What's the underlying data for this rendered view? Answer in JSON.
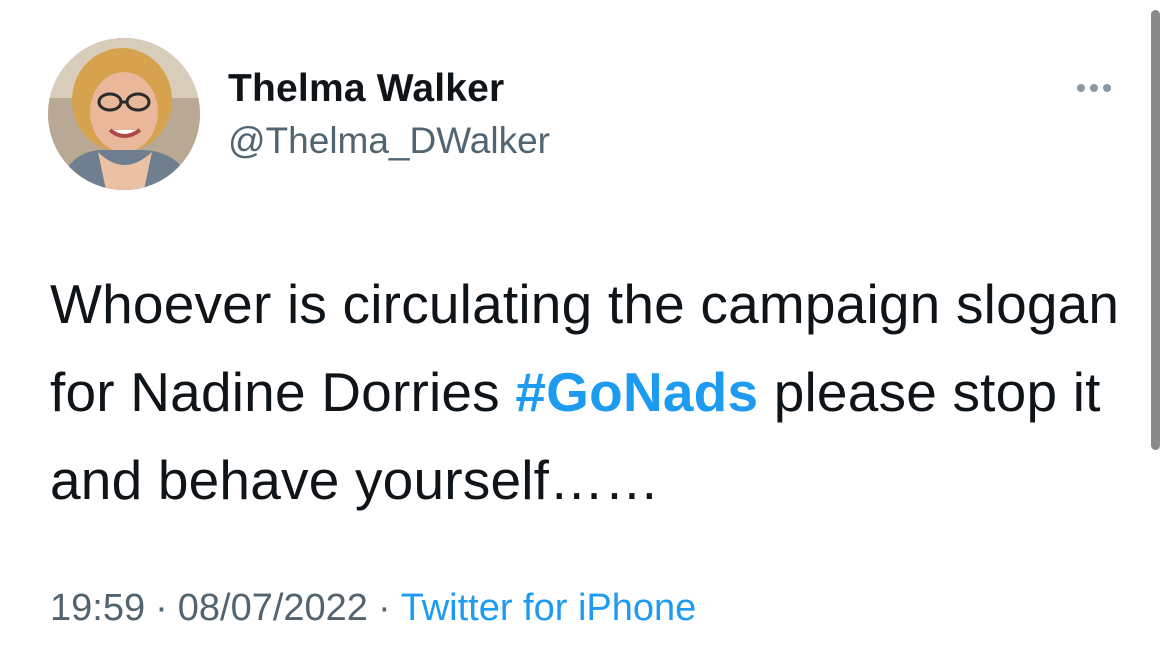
{
  "author": {
    "display_name": "Thelma Walker",
    "handle": "@Thelma_DWalker",
    "avatar_icon": "profile-photo"
  },
  "tweet": {
    "text_before": "Whoever is circulating the campaign slogan for Nadine Dorries ",
    "hashtag": "#GoNads",
    "text_after": " please stop it and behave yourself……"
  },
  "meta": {
    "time": "19:59",
    "separator1": "·",
    "date": "08/07/2022",
    "separator2": "·",
    "source": "Twitter for iPhone"
  },
  "icons": {
    "more": "more-horizontal-icon"
  },
  "colors": {
    "link": "#1d9bf0",
    "secondary_text": "#536471",
    "primary_text": "#0f1419"
  }
}
